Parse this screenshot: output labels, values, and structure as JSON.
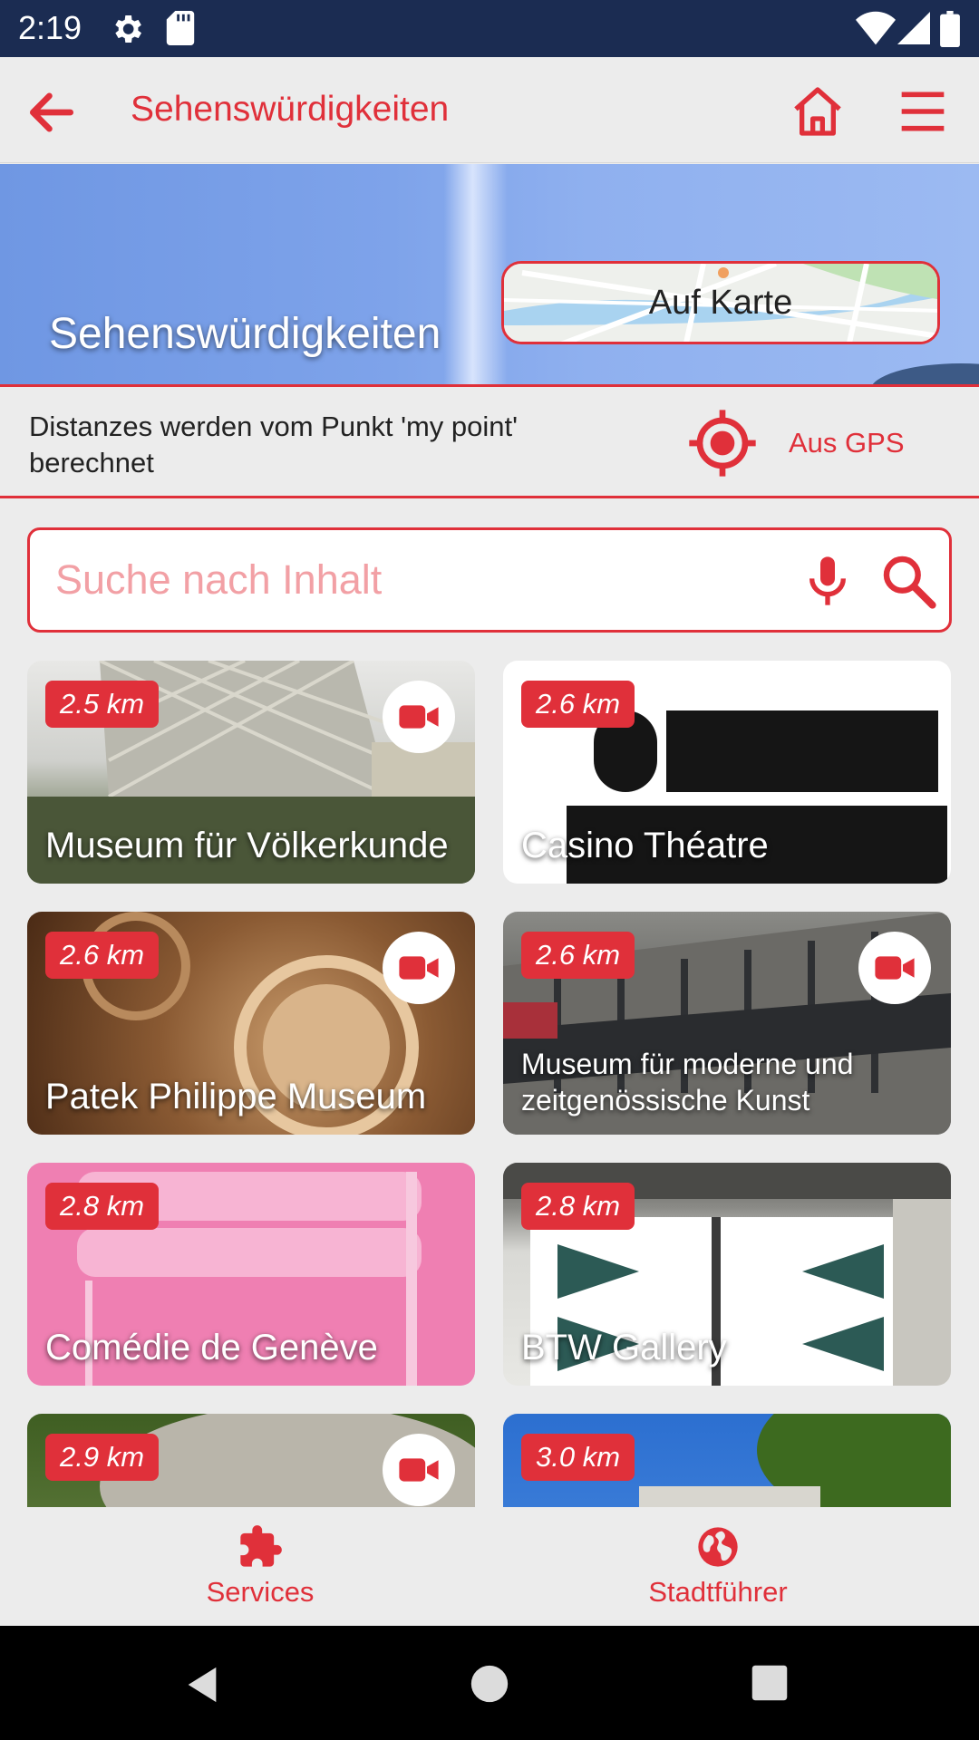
{
  "status_bar": {
    "time": "2:19"
  },
  "app_bar": {
    "title": "Sehenswürdigkeiten"
  },
  "hero": {
    "title": "Sehenswürdigkeiten",
    "map_button": "Auf Karte"
  },
  "distance_bar": {
    "text": "Distanzes werden vom Punkt 'my point' berechnet",
    "gps_label": "Aus GPS"
  },
  "search": {
    "placeholder": "Suche nach Inhalt"
  },
  "cards": [
    {
      "distance": "2.5 km",
      "title": "Museum für Völkerkunde",
      "video": true
    },
    {
      "distance": "2.6 km",
      "title": "Casino Théatre",
      "video": false
    },
    {
      "distance": "2.6 km",
      "title": "Patek Philippe Museum",
      "video": true
    },
    {
      "distance": "2.6 km",
      "title": "Museum für moderne und zeitgenössische Kunst",
      "video": true
    },
    {
      "distance": "2.8 km",
      "title": "Comédie de Genève",
      "video": false
    },
    {
      "distance": "2.8 km",
      "title": "BTW Gallery",
      "video": false
    },
    {
      "distance": "2.9 km",
      "title": "",
      "video": true
    },
    {
      "distance": "3.0 km",
      "title": "",
      "video": false
    }
  ],
  "bottom_nav": {
    "services": "Services",
    "city_guide": "Stadtführer"
  },
  "colors": {
    "accent": "#e0303a",
    "status_bar": "#1b2c52",
    "background": "#ececec"
  }
}
